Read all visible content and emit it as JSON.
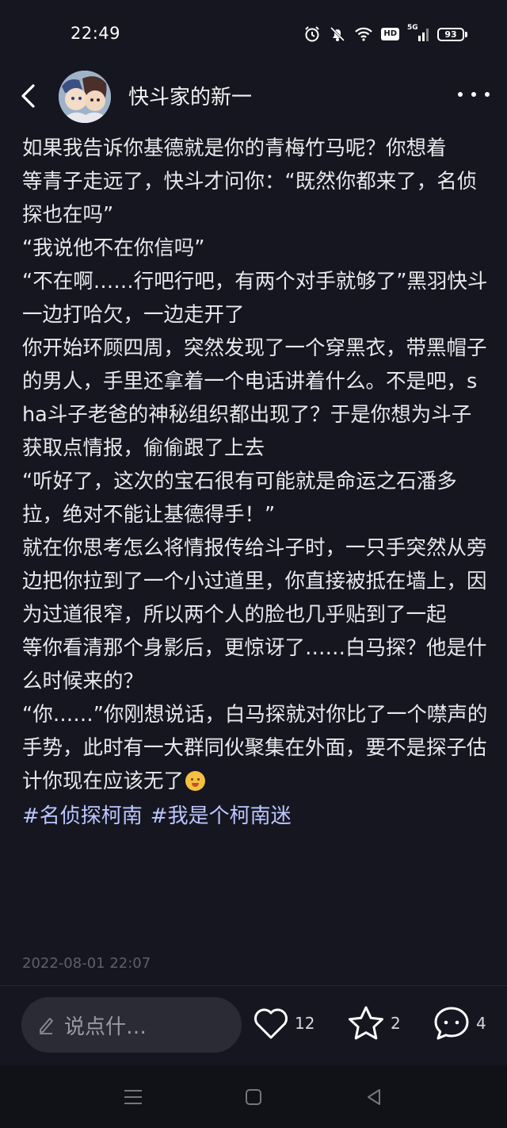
{
  "status_bar": {
    "time": "22:49",
    "network": "5G",
    "hd": "HD",
    "battery": "93"
  },
  "header": {
    "title": "快斗家的新一"
  },
  "post": {
    "paragraphs": [
      "如果我告诉你基德就是你的青梅竹马呢？你想着",
      "等青子走远了，快斗才问你：“既然你都来了，名侦探也在吗”",
      "“我说他不在你信吗”",
      "“不在啊……行吧行吧，有两个对手就够了”黑羽快斗一边打哈欠，一边走开了",
      "你开始环顾四周，突然发现了一个穿黑衣，带黑帽子的男人，手里还拿着一个电话讲着什么。不是吧，sha斗子老爸的神秘组织都出现了？于是你想为斗子获取点情报，偷偷跟了上去",
      "“听好了，这次的宝石很有可能就是命运之石潘多拉，绝对不能让基德得手！”",
      "就在你思考怎么将情报传给斗子时，一只手突然从旁边把你拉到了一个小过道里，你直接被抵在墙上，因为过道很窄，所以两个人的脸也几乎贴到了一起",
      "等你看清那个身影后，更惊讶了……白马探？他是什么时候来的？",
      "“你……”你刚想说话，白马探就对你比了一个噤声的手势，此时有一大群同伙聚集在外面，要不是探子估计你现在应该无了"
    ],
    "hashtags": [
      "#名侦探柯南",
      "#我是个柯南迷"
    ],
    "date": "2022-08-01 22:07"
  },
  "actions": {
    "comment_placeholder": "说点什…",
    "like_count": "12",
    "favorite_count": "2",
    "comment_count": "4"
  },
  "colors": {
    "background": "#161620",
    "hashtag": "#bcc6ff",
    "input_bg": "#2b2b35"
  },
  "icons": [
    "back-arrow-icon",
    "more-dots-icon",
    "pencil-icon",
    "heart-icon",
    "star-icon",
    "chat-bubble-icon",
    "alarm-icon",
    "mute-icon",
    "wifi-icon",
    "signal-icon",
    "battery-icon",
    "menu-icon",
    "home-square-icon",
    "back-triangle-icon"
  ]
}
